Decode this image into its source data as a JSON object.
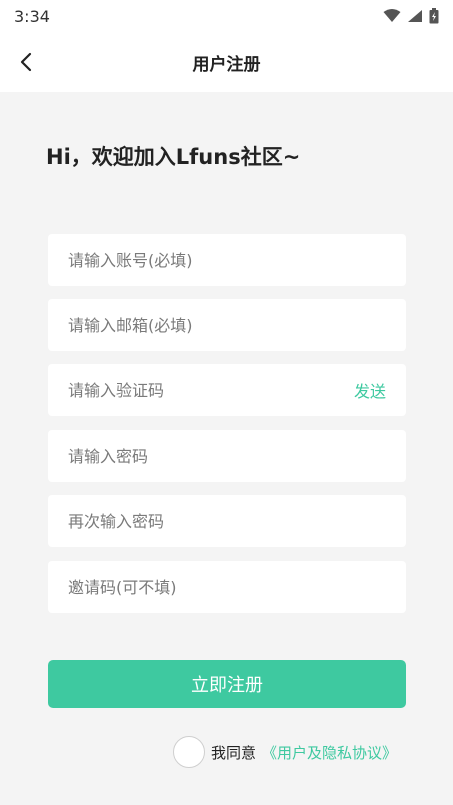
{
  "status_bar": {
    "time": "3:34"
  },
  "header": {
    "title": "用户注册"
  },
  "greeting": "Hi，欢迎加入Lfuns社区~",
  "form": {
    "account_placeholder": "请输入账号(必填)",
    "email_placeholder": "请输入邮箱(必填)",
    "code_placeholder": "请输入验证码",
    "send_label": "发送",
    "password_placeholder": "请输入密码",
    "confirm_password_placeholder": "再次输入密码",
    "invite_placeholder": "邀请码(可不填)"
  },
  "submit_label": "立即注册",
  "agreement": {
    "prefix": "我同意",
    "link": "《用户及隐私协议》",
    "checked": false
  },
  "colors": {
    "accent": "#3ec9a0",
    "background": "#f4f4f4"
  }
}
